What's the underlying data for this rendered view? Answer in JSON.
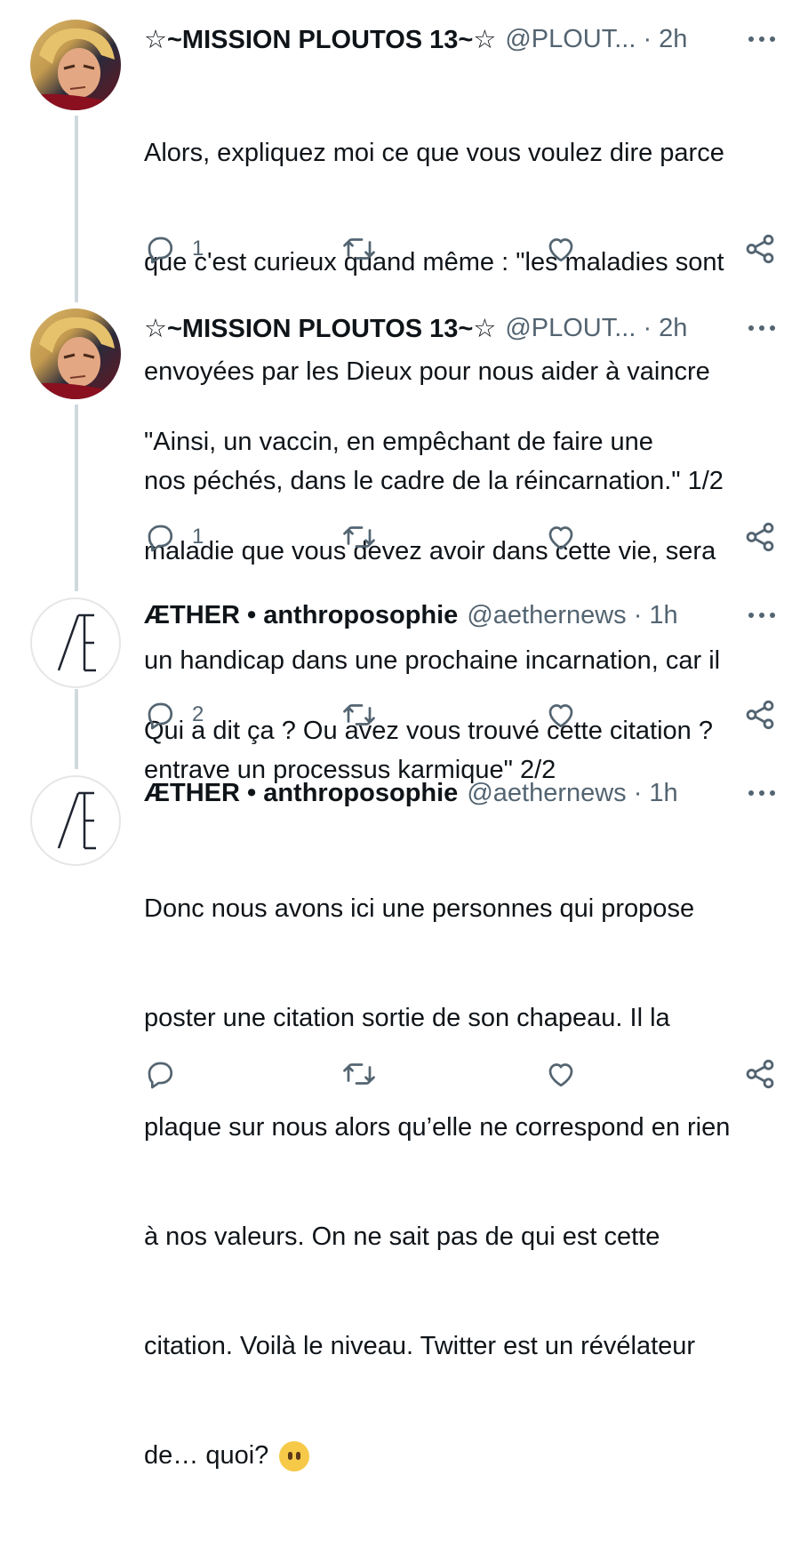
{
  "colors": {
    "text": "#0f1419",
    "muted": "#536471",
    "thread_line": "#cfd9de"
  },
  "tweets": [
    {
      "name": "☆~MISSION PLOUTOS 13~☆",
      "handle": "@PLOUT...",
      "separator": "·",
      "time": "2h",
      "lines": [
        "Alors, expliquez moi ce que vous voulez dire parce",
        "que c'est curieux quand même : \"les maladies sont",
        "envoyées par les Dieux pour nous aider à vaincre",
        "nos péchés, dans le cadre de la réincarnation.\" 1/2"
      ],
      "reply_count": "1",
      "avatar_icon": "cartoon-character-avatar"
    },
    {
      "name": "☆~MISSION PLOUTOS 13~☆",
      "handle": "@PLOUT...",
      "separator": "·",
      "time": "2h",
      "lines": [
        "\"Ainsi, un vaccin, en empêchant de faire une",
        "maladie que vous devez avoir dans cette vie, sera",
        "un handicap dans une prochaine incarnation, car il",
        "entrave un processus karmique\" 2/2"
      ],
      "reply_count": "1",
      "avatar_icon": "cartoon-character-avatar"
    },
    {
      "name": "ÆTHER • anthroposophie",
      "handle": "@aethernews",
      "separator": "·",
      "time": "1h",
      "lines": [
        "Qui a dit ça ? Ou avez vous trouvé cette citation ?"
      ],
      "reply_count": "2",
      "avatar_icon": "ae-logo-avatar"
    },
    {
      "name": "ÆTHER • anthroposophie",
      "handle": "@aethernews",
      "separator": "·",
      "time": "1h",
      "lines": [
        "Donc nous avons ici une personnes qui propose",
        "poster une citation sortie de son chapeau. Il la",
        "plaque sur nous alors qu’elle ne correspond en rien",
        "à nos valeurs. On ne sait pas de qui est cette",
        "citation. Voilà le niveau. Twitter est un révélateur",
        "de… quoi?"
      ],
      "emoji": "neutral-face-no-mouth-emoji",
      "avatar_icon": "ae-logo-avatar"
    }
  ],
  "icons": {
    "reply": "reply-icon",
    "retweet": "retweet-icon",
    "like": "heart-icon",
    "share": "share-icon",
    "more": "more-icon"
  }
}
